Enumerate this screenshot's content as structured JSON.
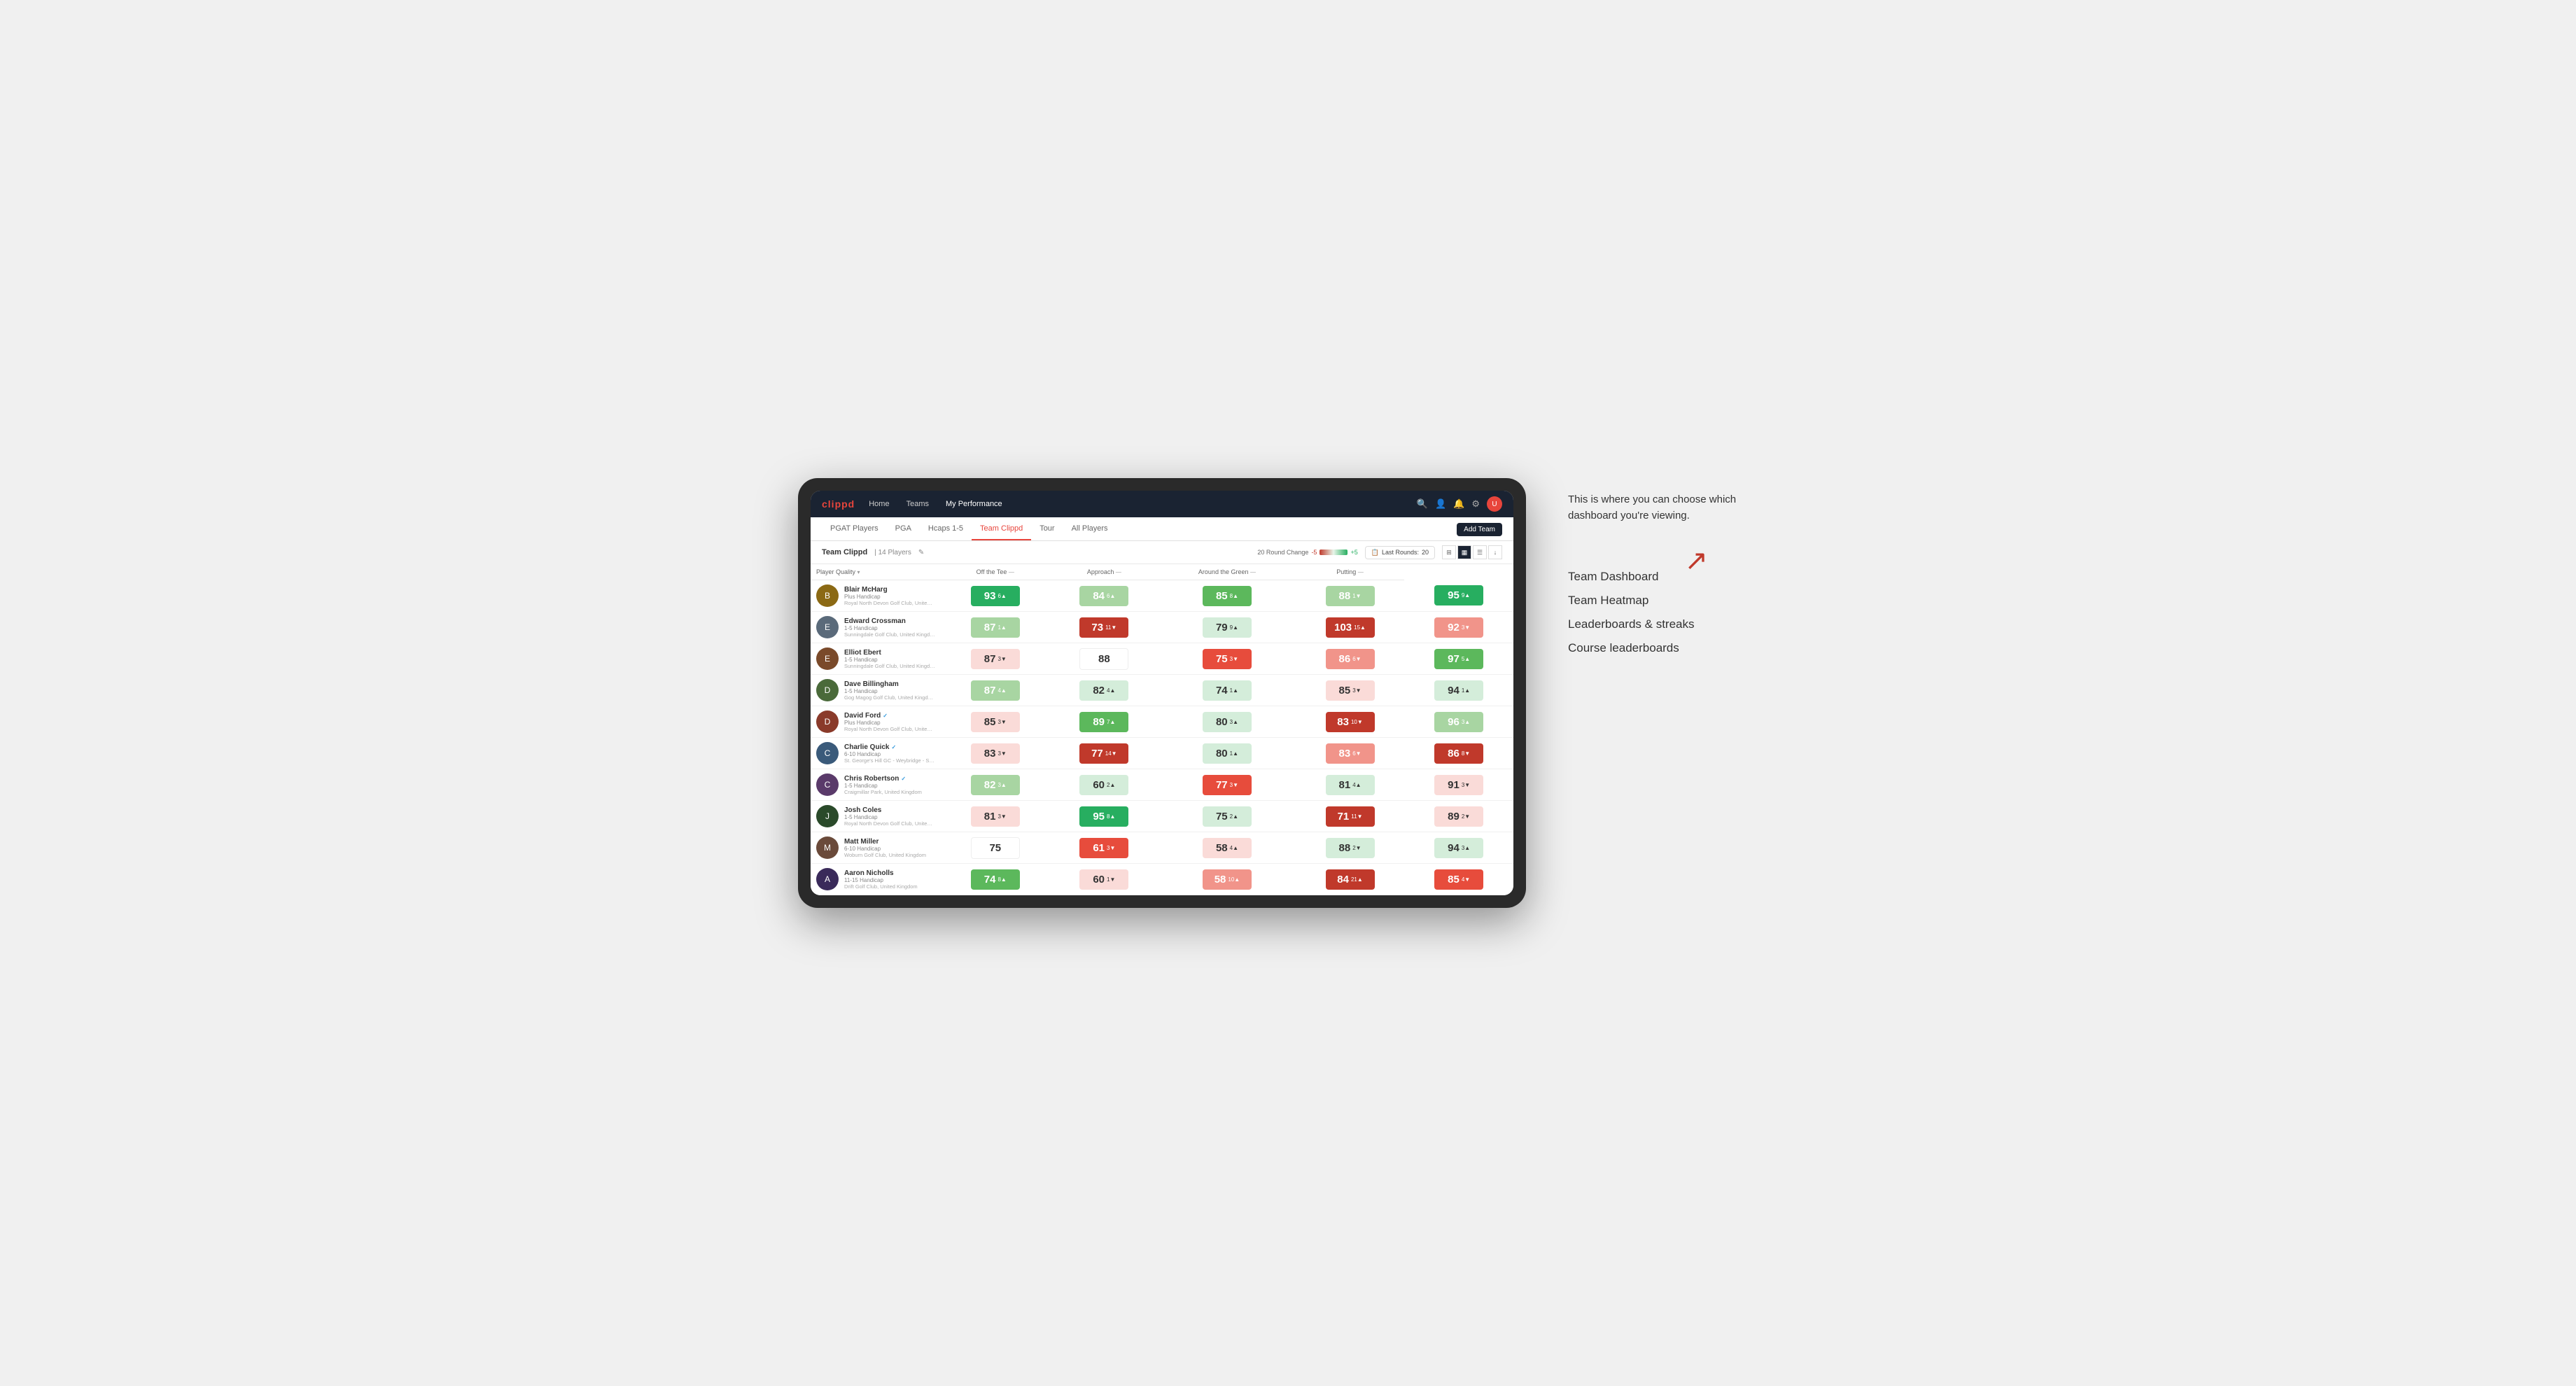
{
  "annotation": {
    "intro_text": "This is where you can choose which dashboard you're viewing.",
    "menu_items": [
      "Team Dashboard",
      "Team Heatmap",
      "Leaderboards & streaks",
      "Course leaderboards"
    ]
  },
  "nav": {
    "logo": "clippd",
    "links": [
      "Home",
      "Teams",
      "My Performance"
    ],
    "icons": [
      "search",
      "user",
      "bell",
      "settings",
      "avatar"
    ]
  },
  "tabs": {
    "items": [
      "PGAT Players",
      "PGA",
      "Hcaps 1-5",
      "Team Clippd",
      "Tour",
      "All Players"
    ],
    "active": "Team Clippd",
    "add_button": "Add Team"
  },
  "sub_header": {
    "team_name": "Team Clippd",
    "separator": "|",
    "player_count": "14 Players",
    "round_change_label": "20 Round Change",
    "scale_neg": "-5",
    "scale_pos": "+5",
    "last_rounds_label": "Last Rounds:",
    "last_rounds_value": "20"
  },
  "table": {
    "columns": [
      "Player Quality",
      "Off the Tee",
      "Approach",
      "Around the Green",
      "Putting"
    ],
    "rows": [
      {
        "name": "Blair McHarg",
        "handicap": "Plus Handicap",
        "club": "Royal North Devon Golf Club, United Kingdom",
        "avatar_letter": "B",
        "avatar_color": "#8B6914",
        "scores": [
          {
            "value": "93",
            "change": "6",
            "dir": "up",
            "color": "green-dark"
          },
          {
            "value": "84",
            "change": "6",
            "dir": "up",
            "color": "green-light"
          },
          {
            "value": "85",
            "change": "8",
            "dir": "up",
            "color": "green-mid"
          },
          {
            "value": "88",
            "change": "1",
            "dir": "down",
            "color": "green-light"
          },
          {
            "value": "95",
            "change": "9",
            "dir": "up",
            "color": "green-dark"
          }
        ]
      },
      {
        "name": "Edward Crossman",
        "handicap": "1-5 Handicap",
        "club": "Sunningdale Golf Club, United Kingdom",
        "avatar_letter": "E",
        "avatar_color": "#5a6a7a",
        "scores": [
          {
            "value": "87",
            "change": "1",
            "dir": "up",
            "color": "green-light"
          },
          {
            "value": "73",
            "change": "11",
            "dir": "down",
            "color": "red-dark"
          },
          {
            "value": "79",
            "change": "9",
            "dir": "up",
            "color": "green-pale"
          },
          {
            "value": "103",
            "change": "15",
            "dir": "up",
            "color": "red-dark"
          },
          {
            "value": "92",
            "change": "3",
            "dir": "down",
            "color": "red-light"
          }
        ]
      },
      {
        "name": "Elliot Ebert",
        "handicap": "1-5 Handicap",
        "club": "Sunningdale Golf Club, United Kingdom",
        "avatar_letter": "E",
        "avatar_color": "#7a4a2a",
        "scores": [
          {
            "value": "87",
            "change": "3",
            "dir": "down",
            "color": "red-pale"
          },
          {
            "value": "88",
            "change": "",
            "dir": "",
            "color": "neutral"
          },
          {
            "value": "75",
            "change": "3",
            "dir": "down",
            "color": "red-mid"
          },
          {
            "value": "86",
            "change": "6",
            "dir": "down",
            "color": "red-light"
          },
          {
            "value": "97",
            "change": "5",
            "dir": "up",
            "color": "green-mid"
          }
        ]
      },
      {
        "name": "Dave Billingham",
        "handicap": "1-5 Handicap",
        "club": "Gog Magog Golf Club, United Kingdom",
        "avatar_letter": "D",
        "avatar_color": "#4a6a3a",
        "scores": [
          {
            "value": "87",
            "change": "4",
            "dir": "up",
            "color": "green-light"
          },
          {
            "value": "82",
            "change": "4",
            "dir": "up",
            "color": "green-pale"
          },
          {
            "value": "74",
            "change": "1",
            "dir": "up",
            "color": "green-pale"
          },
          {
            "value": "85",
            "change": "3",
            "dir": "down",
            "color": "red-pale"
          },
          {
            "value": "94",
            "change": "1",
            "dir": "up",
            "color": "green-pale"
          }
        ]
      },
      {
        "name": "David Ford",
        "handicap": "Plus Handicap",
        "club": "Royal North Devon Golf Club, United Kingdom",
        "avatar_letter": "D",
        "avatar_color": "#8a3a2a",
        "verified": true,
        "scores": [
          {
            "value": "85",
            "change": "3",
            "dir": "down",
            "color": "red-pale"
          },
          {
            "value": "89",
            "change": "7",
            "dir": "up",
            "color": "green-mid"
          },
          {
            "value": "80",
            "change": "3",
            "dir": "up",
            "color": "green-pale"
          },
          {
            "value": "83",
            "change": "10",
            "dir": "down",
            "color": "red-dark"
          },
          {
            "value": "96",
            "change": "3",
            "dir": "up",
            "color": "green-light"
          }
        ]
      },
      {
        "name": "Charlie Quick",
        "handicap": "6-10 Handicap",
        "club": "St. George's Hill GC - Weybridge - Surrey, Uni...",
        "avatar_letter": "C",
        "avatar_color": "#3a5a7a",
        "verified": true,
        "scores": [
          {
            "value": "83",
            "change": "3",
            "dir": "down",
            "color": "red-pale"
          },
          {
            "value": "77",
            "change": "14",
            "dir": "down",
            "color": "red-dark"
          },
          {
            "value": "80",
            "change": "1",
            "dir": "up",
            "color": "green-pale"
          },
          {
            "value": "83",
            "change": "6",
            "dir": "down",
            "color": "red-light"
          },
          {
            "value": "86",
            "change": "8",
            "dir": "down",
            "color": "red-dark"
          }
        ]
      },
      {
        "name": "Chris Robertson",
        "handicap": "1-5 Handicap",
        "club": "Craigmillar Park, United Kingdom",
        "avatar_letter": "C",
        "avatar_color": "#5a3a6a",
        "verified": true,
        "scores": [
          {
            "value": "82",
            "change": "3",
            "dir": "up",
            "color": "green-light"
          },
          {
            "value": "60",
            "change": "2",
            "dir": "up",
            "color": "green-pale"
          },
          {
            "value": "77",
            "change": "3",
            "dir": "down",
            "color": "red-mid"
          },
          {
            "value": "81",
            "change": "4",
            "dir": "up",
            "color": "green-pale"
          },
          {
            "value": "91",
            "change": "3",
            "dir": "down",
            "color": "red-pale"
          }
        ]
      },
      {
        "name": "Josh Coles",
        "handicap": "1-5 Handicap",
        "club": "Royal North Devon Golf Club, United Kingdom",
        "avatar_letter": "J",
        "avatar_color": "#2a4a2a",
        "scores": [
          {
            "value": "81",
            "change": "3",
            "dir": "down",
            "color": "red-pale"
          },
          {
            "value": "95",
            "change": "8",
            "dir": "up",
            "color": "green-dark"
          },
          {
            "value": "75",
            "change": "2",
            "dir": "up",
            "color": "green-pale"
          },
          {
            "value": "71",
            "change": "11",
            "dir": "down",
            "color": "red-dark"
          },
          {
            "value": "89",
            "change": "2",
            "dir": "down",
            "color": "red-pale"
          }
        ]
      },
      {
        "name": "Matt Miller",
        "handicap": "6-10 Handicap",
        "club": "Woburn Golf Club, United Kingdom",
        "avatar_letter": "M",
        "avatar_color": "#6a4a3a",
        "scores": [
          {
            "value": "75",
            "change": "",
            "dir": "",
            "color": "neutral"
          },
          {
            "value": "61",
            "change": "3",
            "dir": "down",
            "color": "red-mid"
          },
          {
            "value": "58",
            "change": "4",
            "dir": "up",
            "color": "red-pale"
          },
          {
            "value": "88",
            "change": "2",
            "dir": "down",
            "color": "green-pale"
          },
          {
            "value": "94",
            "change": "3",
            "dir": "up",
            "color": "green-pale"
          }
        ]
      },
      {
        "name": "Aaron Nicholls",
        "handicap": "11-15 Handicap",
        "club": "Drift Golf Club, United Kingdom",
        "avatar_letter": "A",
        "avatar_color": "#3a2a5a",
        "scores": [
          {
            "value": "74",
            "change": "8",
            "dir": "up",
            "color": "green-mid"
          },
          {
            "value": "60",
            "change": "1",
            "dir": "down",
            "color": "red-pale"
          },
          {
            "value": "58",
            "change": "10",
            "dir": "up",
            "color": "red-light"
          },
          {
            "value": "84",
            "change": "21",
            "dir": "up",
            "color": "red-dark"
          },
          {
            "value": "85",
            "change": "4",
            "dir": "down",
            "color": "red-mid"
          }
        ]
      }
    ]
  }
}
